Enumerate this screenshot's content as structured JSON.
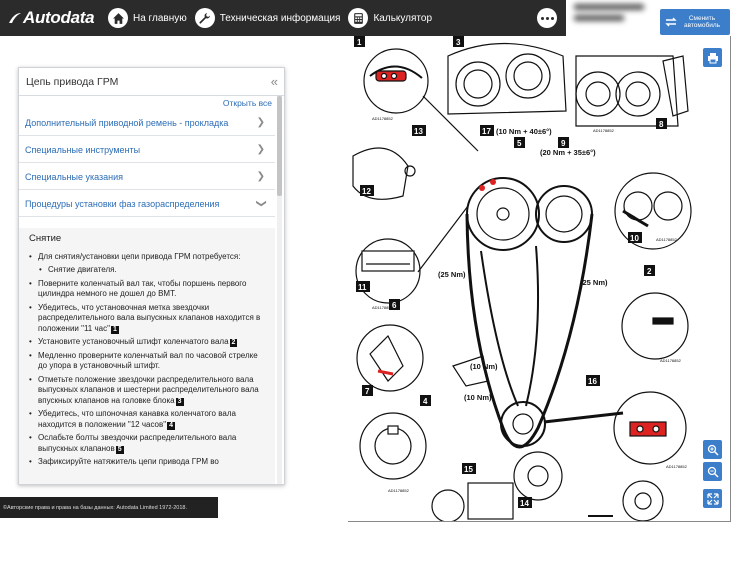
{
  "header": {
    "logo": "Autodata",
    "nav": [
      {
        "label": "На главную",
        "icon": "home-icon"
      },
      {
        "label": "Техническая информация",
        "icon": "wrench-icon"
      },
      {
        "label": "Калькулятор",
        "icon": "calculator-icon"
      }
    ],
    "change_vehicle": "Сменить автомобиль"
  },
  "panel": {
    "title": "Цепь привода ГРМ",
    "open_all": "Открыть все",
    "items": [
      "Дополнительный приводной ремень - прокладка",
      "Специальные инструменты",
      "Специальные указания",
      "Процедуры установки фаз газораспределения"
    ],
    "section_title": "Снятие",
    "steps": [
      {
        "text": "Для снятия/установки цепи привода ГРМ потребуется:",
        "ref": null,
        "sub": false
      },
      {
        "text": "Снятие двигателя.",
        "ref": null,
        "sub": true
      },
      {
        "text": "Поверните коленчатый вал так, чтобы поршень первого цилиндра немного не дошел до ВМТ.",
        "ref": null,
        "sub": false
      },
      {
        "text": "Убедитесь, что установочная метка звездочки распределительного вала выпускных клапанов находится в положении \"11 час\"",
        "ref": "1",
        "sub": false
      },
      {
        "text": "Установите установочный штифт коленчатого вала",
        "ref": "2",
        "sub": false
      },
      {
        "text": "Медленно проверните коленчатый вал по часовой стрелке до упора в установочный штифт.",
        "ref": null,
        "sub": false
      },
      {
        "text": "Отметьте положение звездочки распределительного вала выпускных клапанов и шестерни распределительного вала впускных клапанов на головке блока",
        "ref": "3",
        "sub": false
      },
      {
        "text": "Убедитесь, что шпоночная канавка коленчатого вала находится в положении \"12 часов\"",
        "ref": "4",
        "sub": false
      },
      {
        "text": "Ослабьте болты звездочки распределительного вала выпускных клапанов",
        "ref": "5",
        "sub": false
      },
      {
        "text": "Зафиксируйте натяжитель цепи привода ГРМ во",
        "ref": null,
        "sub": false
      }
    ]
  },
  "copyright": "©Авторские права и права на базы данных: Autodata Limited 1972-2018.",
  "diagram": {
    "torque_top": "(10 Nm + 40±6°)",
    "torque_top2": "(20 Nm + 35±6°)",
    "torque_25_left": "(25 Nm)",
    "torque_25_right": "(25 Nm)",
    "torque_10_right": "(10 Nm)",
    "torque_10_bottom": "(10 Nm)",
    "ref_code": "AD1178852",
    "labels": [
      "1",
      "2",
      "3",
      "4",
      "5",
      "6",
      "7",
      "8",
      "9",
      "10",
      "11",
      "12",
      "13",
      "14",
      "15",
      "16",
      "17"
    ]
  }
}
